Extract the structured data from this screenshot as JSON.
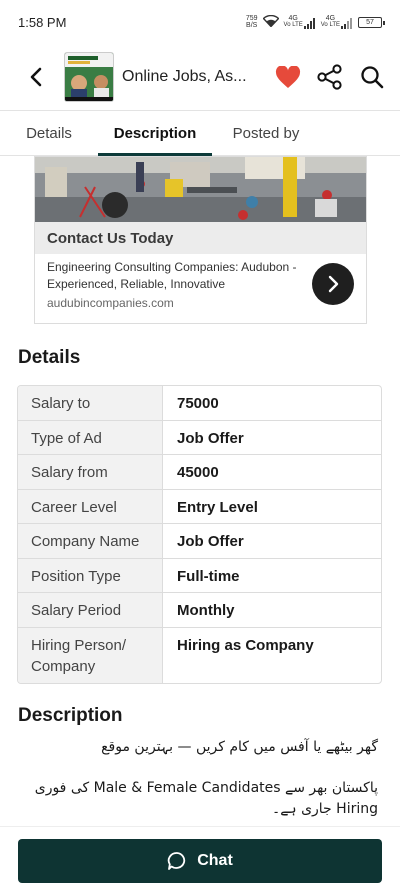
{
  "status_bar": {
    "time": "1:58 PM",
    "speed_value": "759",
    "speed_unit": "B/S",
    "net1": "Vo LTE",
    "net1_type": "4G",
    "net2": "Vo LTE",
    "net2_type": "4G",
    "battery": "57"
  },
  "app_bar": {
    "title": "Online Jobs, As...",
    "favorite_color": "#e64a3b"
  },
  "tabs": [
    {
      "label": "Details",
      "active": false
    },
    {
      "label": "Description",
      "active": true
    },
    {
      "label": "Posted by",
      "active": false
    }
  ],
  "ad": {
    "headline": "Contact Us Today",
    "body": "Engineering Consulting Companies: Audubon - Experienced, Reliable, Innovative",
    "domain": "audubincompanies.com"
  },
  "details": {
    "title": "Details",
    "rows": [
      {
        "label": "Salary to",
        "value": "75000"
      },
      {
        "label": "Type of Ad",
        "value": "Job Offer"
      },
      {
        "label": "Salary from",
        "value": "45000"
      },
      {
        "label": "Career Level",
        "value": "Entry Level"
      },
      {
        "label": "Company Name",
        "value": "Job Offer"
      },
      {
        "label": "Position Type",
        "value": "Full-time"
      },
      {
        "label": "Salary Period",
        "value": "Monthly"
      },
      {
        "label": "Hiring Person/ Company",
        "value": "Hiring as Company"
      }
    ]
  },
  "description": {
    "title": "Description",
    "line1": "گھر بیٹھے یا آفس میں کام کریں — بہترین موقع",
    "line2": "پاکستان بھر سے Male & Female Candidates کی فوری",
    "line3": "Hiring جاری ہے۔"
  },
  "bottom": {
    "chat_label": "Chat",
    "brand_color": "#0e3433"
  }
}
